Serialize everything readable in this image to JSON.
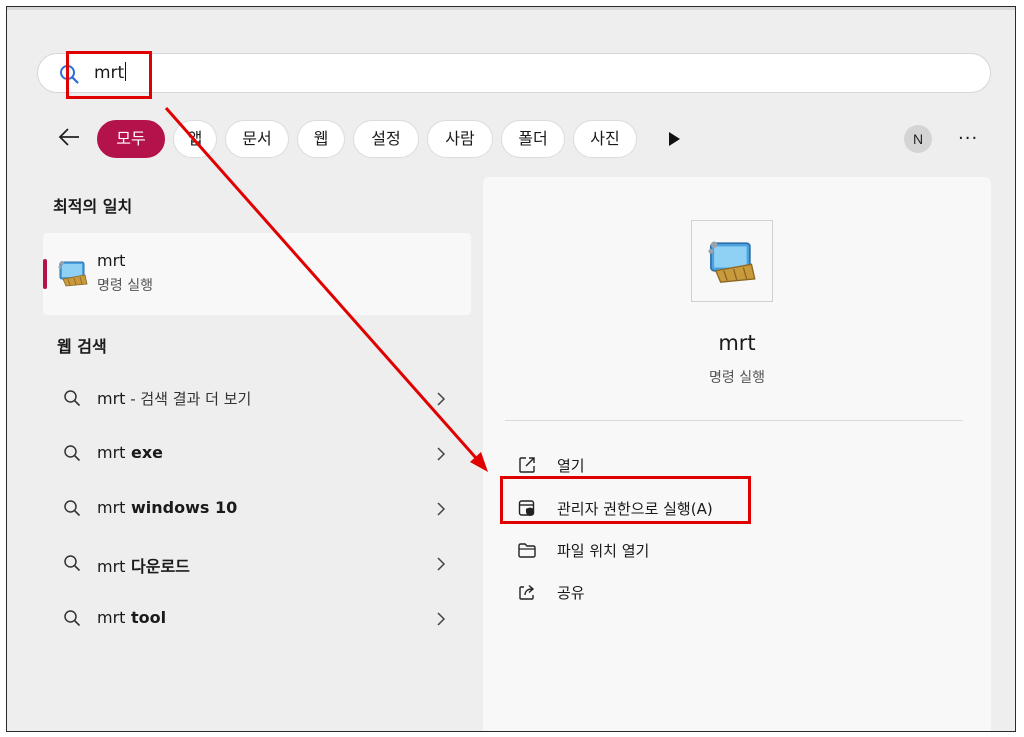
{
  "search": {
    "value": "mrt"
  },
  "filters": {
    "items": [
      {
        "label": "모두",
        "active": true
      },
      {
        "label": "앱",
        "active": false
      },
      {
        "label": "문서",
        "active": false
      },
      {
        "label": "웹",
        "active": false
      },
      {
        "label": "설정",
        "active": false
      },
      {
        "label": "사람",
        "active": false
      },
      {
        "label": "폴더",
        "active": false
      },
      {
        "label": "사진",
        "active": false
      }
    ],
    "avatar_initial": "N",
    "more": "···"
  },
  "best_match": {
    "heading": "최적의 일치",
    "name": "mrt",
    "type": "명령 실행"
  },
  "web_search": {
    "heading": "웹 검색",
    "items": [
      {
        "prefix": "mrt",
        "bold": "",
        "suffix": " - 검색 결과 더 보기"
      },
      {
        "prefix": "mrt",
        "bold": " exe",
        "suffix": ""
      },
      {
        "prefix": "mrt",
        "bold": " windows 10",
        "suffix": ""
      },
      {
        "prefix": "mrt",
        "bold": " 다운로드",
        "suffix": ""
      },
      {
        "prefix": "mrt",
        "bold": " tool",
        "suffix": ""
      }
    ]
  },
  "detail": {
    "title": "mrt",
    "type": "명령 실행",
    "actions": [
      {
        "label": "열기",
        "icon": "open-external-icon"
      },
      {
        "label": "관리자 권한으로 실행(A)",
        "icon": "shield-icon"
      },
      {
        "label": "파일 위치 열기",
        "icon": "folder-icon"
      },
      {
        "label": "공유",
        "icon": "share-icon"
      }
    ]
  },
  "colors": {
    "accent": "#b3124a",
    "annotation": "#e00000"
  }
}
